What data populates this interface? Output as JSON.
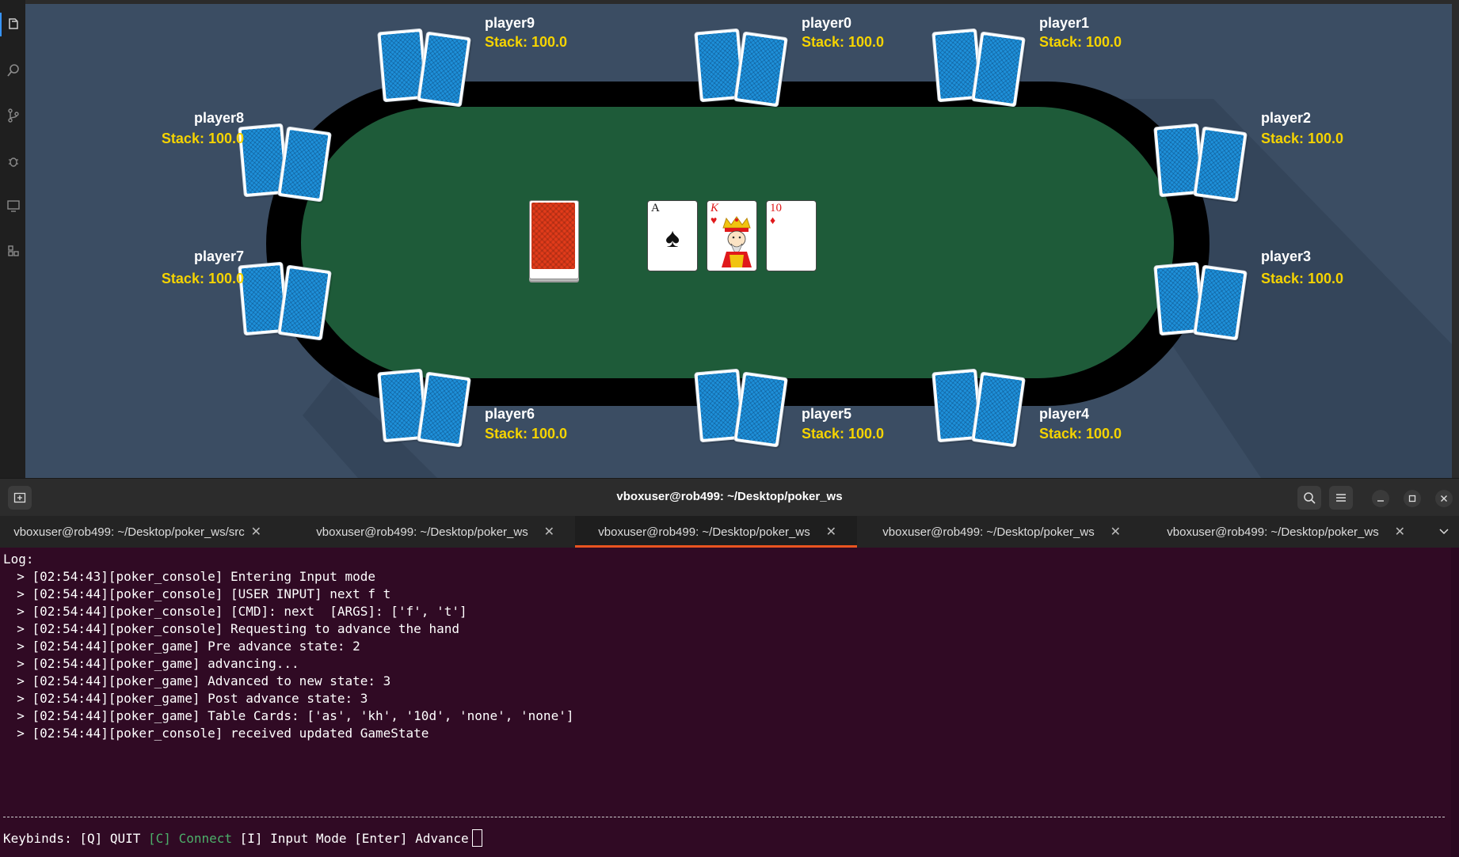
{
  "game": {
    "players": [
      {
        "name": "player0",
        "stack": "Stack: 100.0"
      },
      {
        "name": "player1",
        "stack": "Stack: 100.0"
      },
      {
        "name": "player2",
        "stack": "Stack: 100.0"
      },
      {
        "name": "player3",
        "stack": "Stack: 100.0"
      },
      {
        "name": "player4",
        "stack": "Stack: 100.0"
      },
      {
        "name": "player5",
        "stack": "Stack: 100.0"
      },
      {
        "name": "player6",
        "stack": "Stack: 100.0"
      },
      {
        "name": "player7",
        "stack": "Stack: 100.0"
      },
      {
        "name": "player8",
        "stack": "Stack: 100.0"
      },
      {
        "name": "player9",
        "stack": "Stack: 100.0"
      }
    ],
    "table_cards": [
      {
        "rank": "A",
        "suit": "♠",
        "color": "#111111"
      },
      {
        "rank": "K",
        "suit": "♥",
        "color": "#e0191b"
      },
      {
        "rank": "10",
        "suit": "♦",
        "color": "#e0191b"
      }
    ],
    "colors": {
      "felt": "#1e5b39",
      "card_back": "#1e8fd8",
      "deck_back": "#e23b1a",
      "stack_text": "#f5d300"
    }
  },
  "terminal": {
    "window_title": "vboxuser@rob499: ~/Desktop/poker_ws",
    "tabs": [
      {
        "label": "vboxuser@rob499: ~/Desktop/poker_ws/src"
      },
      {
        "label": "vboxuser@rob499: ~/Desktop/poker_ws"
      },
      {
        "label": "vboxuser@rob499: ~/Desktop/poker_ws"
      },
      {
        "label": "vboxuser@rob499: ~/Desktop/poker_ws"
      },
      {
        "label": "vboxuser@rob499: ~/Desktop/poker_ws"
      }
    ],
    "active_tab": 2,
    "log_header": "Log:",
    "log_lines": [
      "  > [02:54:43][poker_console] Entering Input mode",
      "  > [02:54:44][poker_console] [USER INPUT] next f t",
      "  > [02:54:44][poker_console] [CMD]: next  [ARGS]: ['f', 't']",
      "  > [02:54:44][poker_console] Requesting to advance the hand",
      "  > [02:54:44][poker_game] Pre advance state: 2",
      "  > [02:54:44][poker_game] advancing...",
      "  > [02:54:44][poker_game] Advanced to new state: 3",
      "  > [02:54:44][poker_game] Post advance state: 3",
      "  > [02:54:44][poker_game] Table Cards: ['as', 'kh', '10d', 'none', 'none']",
      "  > [02:54:44][poker_console] received updated GameState"
    ],
    "keybinds": {
      "prefix": "Keybinds: [Q] QUIT ",
      "connect": "[C] Connect",
      "rest": " [I] Input Mode [Enter] Advance"
    }
  }
}
